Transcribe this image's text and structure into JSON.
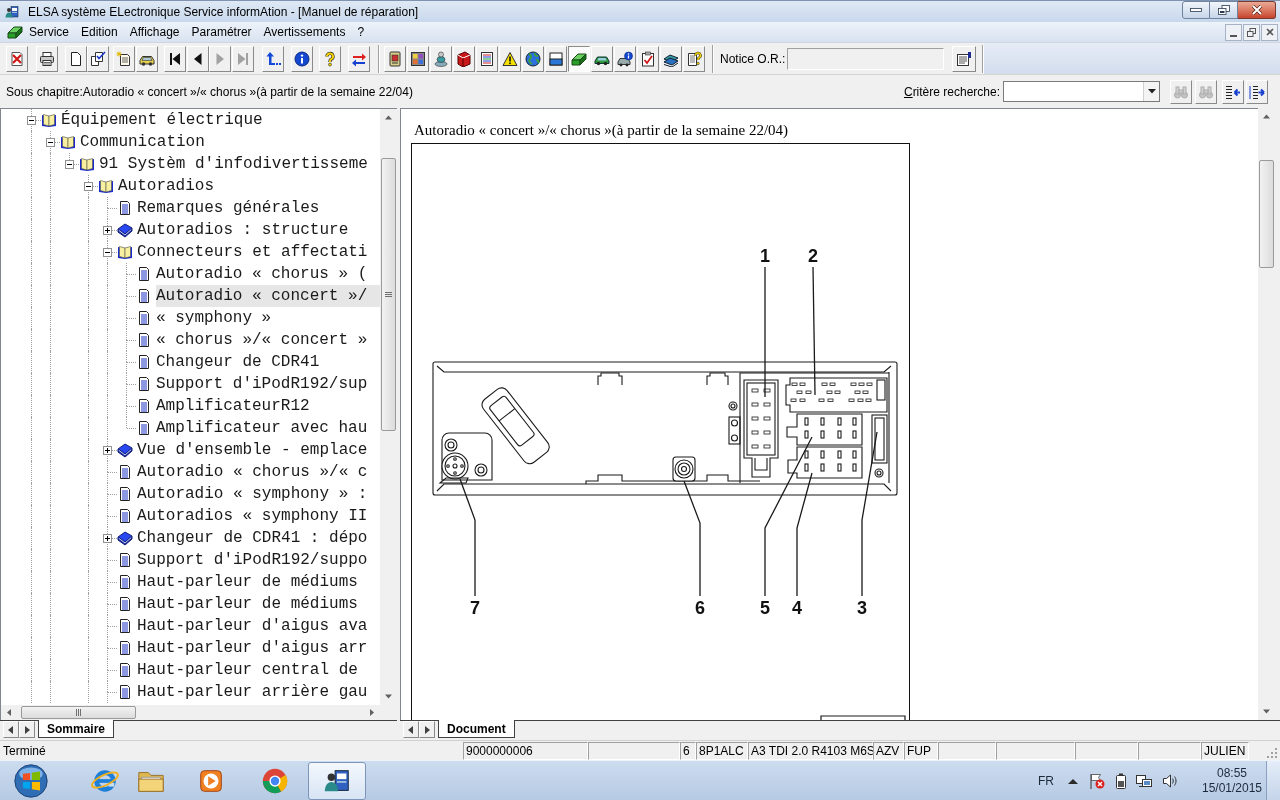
{
  "window": {
    "title": "ELSA système ELectronique Service informAtion - [Manuel de réparation]"
  },
  "menu": [
    "Service",
    "Edition",
    "Affichage",
    "Paramétrer",
    "Avertissements",
    "?"
  ],
  "toolbar": {
    "buttons": [
      {
        "disabled": false,
        "pressed": false
      },
      {
        "disabled": false,
        "pressed": false
      },
      {
        "disabled": false,
        "pressed": false
      },
      {
        "disabled": false,
        "pressed": false
      },
      {
        "disabled": false,
        "pressed": false
      },
      {
        "disabled": false,
        "pressed": false
      },
      {
        "disabled": false,
        "pressed": false
      },
      {
        "disabled": false,
        "pressed": false
      },
      {
        "disabled": true,
        "pressed": false
      },
      {
        "disabled": true,
        "pressed": false
      },
      {
        "disabled": false,
        "pressed": false
      },
      {
        "disabled": false,
        "pressed": false
      },
      {
        "disabled": false,
        "pressed": false
      },
      {
        "disabled": false,
        "pressed": false
      },
      {
        "disabled": false,
        "pressed": false
      },
      {
        "disabled": false,
        "pressed": false
      },
      {
        "disabled": false,
        "pressed": false
      },
      {
        "disabled": false,
        "pressed": false
      },
      {
        "disabled": false,
        "pressed": false
      },
      {
        "disabled": false,
        "pressed": false
      },
      {
        "disabled": false,
        "pressed": false
      },
      {
        "disabled": false,
        "pressed": false
      },
      {
        "disabled": false,
        "pressed": true
      },
      {
        "disabled": false,
        "pressed": false
      },
      {
        "disabled": false,
        "pressed": false
      },
      {
        "disabled": false,
        "pressed": false
      },
      {
        "disabled": false,
        "pressed": false
      },
      {
        "disabled": false,
        "pressed": false
      }
    ],
    "notice": {
      "label": "Notice O.R.:"
    }
  },
  "subchapter": "Sous chapitre:Autoradio « concert »/« chorus »(à partir de la semaine 22/04)",
  "search": {
    "label": "Critère recherche:",
    "buttons": [
      {
        "disabled": true
      },
      {
        "disabled": true
      },
      {
        "disabled": false
      },
      {
        "disabled": false
      }
    ]
  },
  "left_panel": {
    "tree": [
      {
        "label": "Équipement électrique",
        "kind": "folder",
        "expanded": true,
        "selected": false,
        "continues": true,
        "children": [
          {
            "label": "Communication",
            "kind": "folder",
            "expanded": true,
            "selected": false,
            "continues": true,
            "children": [
              {
                "label": "91 Systèm d'infodivertisseme",
                "kind": "folder",
                "expanded": true,
                "selected": false,
                "children": [
                  {
                    "label": "Autoradios",
                    "kind": "folder",
                    "expanded": true,
                    "selected": false,
                    "continues": true,
                    "children": [
                      {
                        "label": "Remarques générales",
                        "kind": "document",
                        "selected": false
                      },
                      {
                        "label": "Autoradios : structure",
                        "kind": "folder",
                        "expanded": false,
                        "selected": false
                      },
                      {
                        "label": "Connecteurs et affectati",
                        "kind": "folder",
                        "expanded": true,
                        "selected": false,
                        "children": [
                          {
                            "label": "Autoradio « chorus » (",
                            "kind": "document",
                            "selected": false
                          },
                          {
                            "label": "Autoradio « concert »/",
                            "kind": "document",
                            "selected": true
                          },
                          {
                            "label": "« symphony »",
                            "kind": "document",
                            "selected": false
                          },
                          {
                            "label": "« chorus »/« concert »",
                            "kind": "document",
                            "selected": false
                          },
                          {
                            "label": "Changeur de CDR41",
                            "kind": "document",
                            "selected": false
                          },
                          {
                            "label": "Support d'iPodR192/sup",
                            "kind": "document",
                            "selected": false
                          },
                          {
                            "label": "AmplificateurR12",
                            "kind": "document",
                            "selected": false
                          },
                          {
                            "label": "Amplificateur avec hau",
                            "kind": "document",
                            "selected": false
                          }
                        ]
                      },
                      {
                        "label": "Vue d'ensemble - emplace",
                        "kind": "folder",
                        "expanded": false,
                        "selected": false
                      },
                      {
                        "label": "Autoradio « chorus »/« c",
                        "kind": "document",
                        "selected": false
                      },
                      {
                        "label": "Autoradio « symphony » :",
                        "kind": "document",
                        "selected": false
                      },
                      {
                        "label": "Autoradios « symphony II",
                        "kind": "document",
                        "selected": false
                      },
                      {
                        "label": "Changeur de CDR41 : dépo",
                        "kind": "folder",
                        "expanded": false,
                        "selected": false
                      },
                      {
                        "label": "Support d'iPodR192/suppo",
                        "kind": "document",
                        "selected": false
                      },
                      {
                        "label": "Haut-parleur de médiums",
                        "kind": "document",
                        "selected": false
                      },
                      {
                        "label": "Haut-parleur de médiums",
                        "kind": "document",
                        "selected": false
                      },
                      {
                        "label": "Haut-parleur d'aigus ava",
                        "kind": "document",
                        "selected": false
                      },
                      {
                        "label": "Haut-parleur d'aigus arr",
                        "kind": "document",
                        "selected": false
                      },
                      {
                        "label": "Haut-parleur central de",
                        "kind": "document",
                        "selected": false
                      },
                      {
                        "label": "Haut-parleur arrière gau",
                        "kind": "document",
                        "selected": false,
                        "continues": true
                      }
                    ]
                  }
                ]
              }
            ]
          }
        ]
      }
    ],
    "tabs": [
      {
        "label": "Sommaire",
        "selected": true
      }
    ]
  },
  "right_panel": {
    "document": {
      "title": "Autoradio « concert »/« chorus »(à partir de la semaine 22/04)",
      "figure": {
        "callouts": [
          "1",
          "2",
          "7",
          "6",
          "5",
          "4",
          "3"
        ]
      }
    },
    "tabs": [
      {
        "label": "Document",
        "selected": true
      }
    ]
  },
  "status_bar": {
    "message": "Terminé",
    "panels": [
      "9000000006",
      "6",
      "8P1ALC",
      "A3 TDI 2.0 R4103 M6S",
      "AZV",
      "FUP",
      "JULIEN"
    ]
  },
  "taskbar": {
    "apps": [
      {
        "selected": false
      },
      {
        "selected": false
      },
      {
        "selected": false
      },
      {
        "selected": false
      },
      {
        "selected": true
      }
    ],
    "language": "FR",
    "time": "08:55",
    "date": "15/01/2015"
  }
}
